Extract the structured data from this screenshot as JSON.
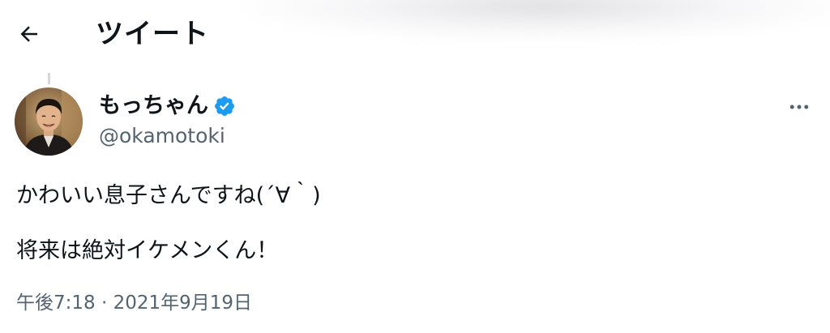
{
  "header": {
    "title": "ツイート",
    "back_icon": "arrow-left-icon"
  },
  "tweet": {
    "author": {
      "display_name": "もっちゃん",
      "handle": "@okamotoki",
      "verified_icon": "verified-badge-icon",
      "verified_color": "#1d9bf0"
    },
    "more_icon": "more-horizontal-icon",
    "text_lines": [
      "かわいい息子さんですね(´∀｀)",
      "将来は絶対イケメンくん！"
    ],
    "time": "午後7:18",
    "separator": "·",
    "date": "2021年9月19日"
  },
  "colors": {
    "text_primary": "#0f1419",
    "text_secondary": "#536471",
    "accent": "#1d9bf0"
  }
}
